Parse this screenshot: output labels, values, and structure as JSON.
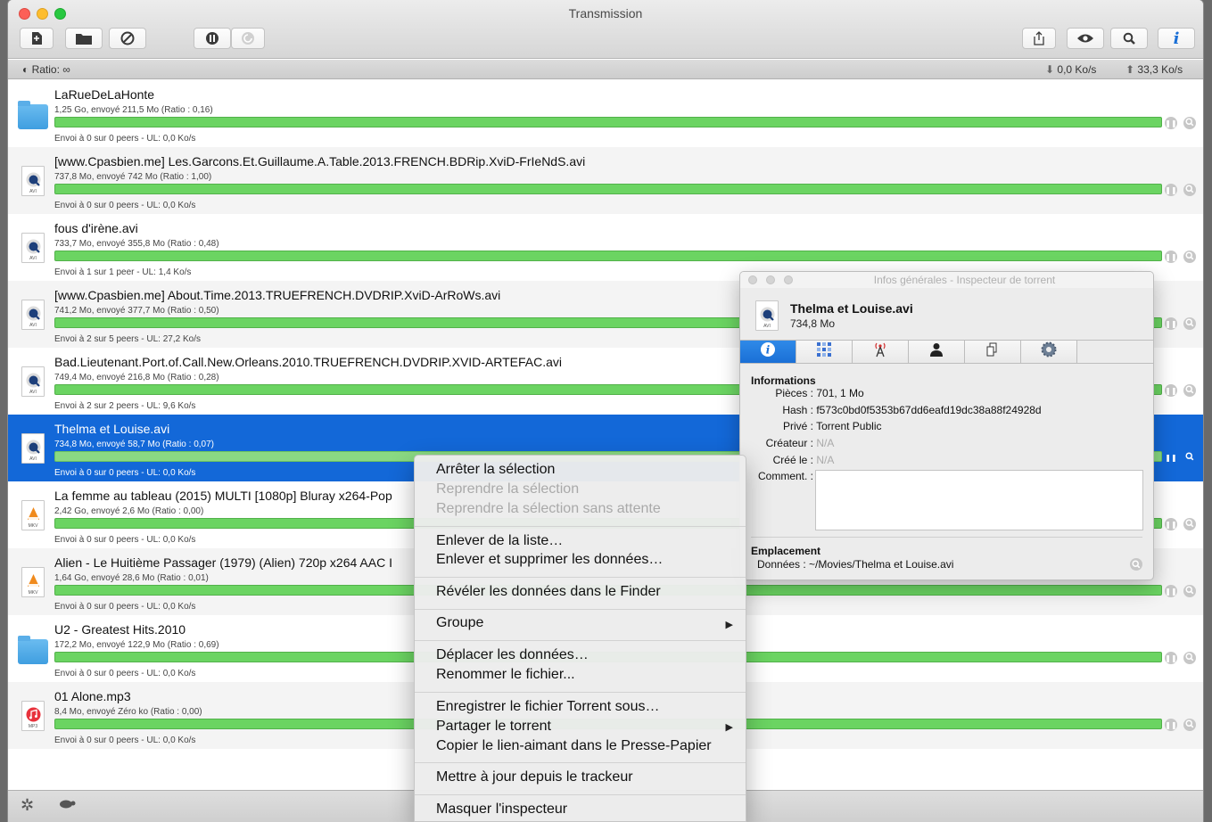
{
  "window": {
    "title": "Transmission"
  },
  "toolbar": {
    "icons": [
      "new-torrent-icon",
      "open-folder-icon",
      "remove-icon",
      "pause-all-icon",
      "resume-all-icon",
      "share-icon",
      "quicklook-icon",
      "search-icon",
      "inspector-info-icon"
    ]
  },
  "statusbar": {
    "ratio": "Ratio: ∞",
    "download": "0,0 Ko/s",
    "upload": "33,3 Ko/s"
  },
  "torrents": [
    {
      "name": "LaRueDeLaHonte",
      "info": "1,25 Go, envoyé 211,5 Mo (Ratio : 0,16)",
      "status": "Envoi à 0 sur 0 peers - UL: 0,0 Ko/s",
      "icon": "folder",
      "progress": 1.0
    },
    {
      "name": "[www.Cpasbien.me] Les.Garcons.Et.Guillaume.A.Table.2013.FRENCH.BDRip.XviD-FrIeNdS.avi",
      "info": "737,8 Mo, envoyé 742 Mo (Ratio : 1,00)",
      "status": "Envoi à 0 sur 0 peers - UL: 0,0 Ko/s",
      "icon": "avi",
      "progress": 1.0
    },
    {
      "name": "fous d'irène.avi",
      "info": "733,7 Mo, envoyé 355,8 Mo (Ratio : 0,48)",
      "status": "Envoi à 1 sur 1 peer - UL: 1,4 Ko/s",
      "icon": "avi",
      "progress": 1.0
    },
    {
      "name": "[www.Cpasbien.me] About.Time.2013.TRUEFRENCH.DVDRIP.XviD-ArRoWs.avi",
      "info": "741,2 Mo, envoyé 377,7 Mo (Ratio : 0,50)",
      "status": "Envoi à 2 sur 5 peers - UL: 27,2 Ko/s",
      "icon": "avi",
      "progress": 1.0
    },
    {
      "name": "Bad.Lieutenant.Port.of.Call.New.Orleans.2010.TRUEFRENCH.DVDRIP.XVID-ARTEFAC.avi",
      "info": "749,4 Mo, envoyé 216,8 Mo (Ratio : 0,28)",
      "status": "Envoi à 2 sur 2 peers - UL: 9,6 Ko/s",
      "icon": "avi",
      "progress": 1.0
    },
    {
      "name": "Thelma et Louise.avi",
      "info": "734,8 Mo, envoyé 58,7 Mo (Ratio : 0,07)",
      "status": "Envoi à 0 sur 0 peers - UL: 0,0 Ko/s",
      "icon": "avi",
      "progress": 1.0,
      "selected": true
    },
    {
      "name": "La femme au tableau (2015) MULTI [1080p] Bluray x264-Pop",
      "info": "2,42 Go, envoyé 2,6 Mo (Ratio : 0,00)",
      "status": "Envoi à 0 sur 0 peers - UL: 0,0 Ko/s",
      "icon": "mkv",
      "progress": 1.0
    },
    {
      "name": "Alien - Le Huitième Passager (1979) (Alien) 720p x264 AAC I",
      "info": "1,64 Go, envoyé 28,6 Mo (Ratio : 0,01)",
      "status": "Envoi à 0 sur 0 peers - UL: 0,0 Ko/s",
      "icon": "mkv",
      "progress": 1.0
    },
    {
      "name": "U2 - Greatest Hits.2010",
      "info": "172,2 Mo, envoyé 122,9 Mo (Ratio : 0,69)",
      "status": "Envoi à 0 sur 0 peers - UL: 0,0 Ko/s",
      "icon": "folder",
      "progress": 1.0
    },
    {
      "name": "01 Alone.mp3",
      "info": "8,4 Mo, envoyé Zéro ko (Ratio : 0,00)",
      "status": "Envoi à 0 sur 0 peers - UL: 0,0 Ko/s",
      "icon": "mp3",
      "progress": 1.0
    }
  ],
  "inspector": {
    "title": "Infos générales - Inspecteur de torrent",
    "name": "Thelma et Louise.avi",
    "size": "734,8 Mo",
    "tabs": [
      "info-icon",
      "pieces-icon",
      "tracker-icon",
      "peers-icon",
      "files-icon",
      "options-icon"
    ],
    "section_info": "Informations",
    "pieces_label": "Pièces :",
    "pieces_value": "701, 1 Mo",
    "hash_label": "Hash :",
    "hash_value": "f573c0bd0f5353b67dd6eafd19dc38a88f24928d",
    "private_label": "Privé :",
    "private_value": "Torrent Public",
    "creator_label": "Créateur :",
    "creator_value": "N/A",
    "created_label": "Créé le :",
    "created_value": "N/A",
    "comment_label": "Comment. :",
    "section_location": "Emplacement",
    "data_label": "Données :",
    "data_value": "~/Movies/Thelma et Louise.avi"
  },
  "context_menu": {
    "stop": "Arrêter la sélection",
    "resume": "Reprendre la sélection",
    "resume_now": "Reprendre la sélection sans attente",
    "remove": "Enlever de la liste…",
    "remove_delete": "Enlever et supprimer les données…",
    "reveal": "Révéler les données dans le Finder",
    "group": "Groupe",
    "move": "Déplacer les données…",
    "rename": "Renommer le fichier...",
    "save_torrent": "Enregistrer le fichier Torrent sous…",
    "share": "Partager le torrent",
    "copy_magnet": "Copier le lien-aimant dans le Presse-Papier",
    "update_tracker": "Mettre à jour depuis le trackeur",
    "hide_inspector": "Masquer l'inspecteur"
  },
  "colors": {
    "accent": "#1368d8",
    "progress": "#6bd462"
  }
}
